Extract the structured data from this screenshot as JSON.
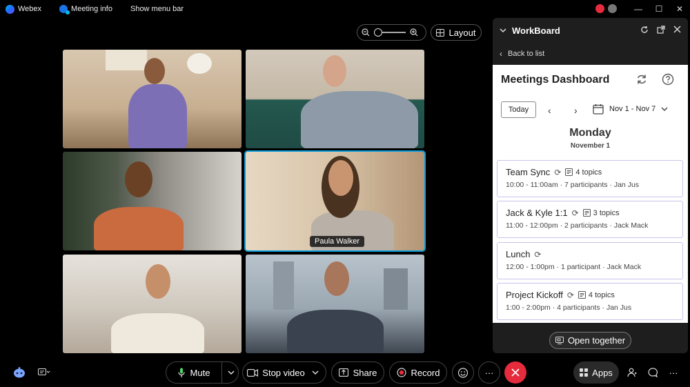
{
  "titlebar": {
    "app_name": "Webex",
    "meeting_info": "Meeting info",
    "show_menu_bar": "Show menu bar"
  },
  "view_controls": {
    "layout_label": "Layout"
  },
  "participants": [
    {
      "tile": 1
    },
    {
      "tile": 2
    },
    {
      "tile": 3
    },
    {
      "tile": 4,
      "name": "Paula Walker",
      "active_speaker": true
    },
    {
      "tile": 5
    },
    {
      "tile": 6
    }
  ],
  "workboard": {
    "title": "WorkBoard",
    "back_label": "Back to list",
    "dashboard_title": "Meetings Dashboard",
    "today_label": "Today",
    "date_range": "Nov 1 - Nov 7",
    "day_name": "Monday",
    "day_date": "November 1",
    "meetings": [
      {
        "title": "Team Sync",
        "recurring": true,
        "topics": "4 topics",
        "time": "10:00 - 11:00am",
        "participants": "7 participants",
        "owner": "Jan Jus"
      },
      {
        "title": "Jack & Kyle 1:1",
        "recurring": true,
        "topics": "3 topics",
        "time": "11:00 - 12:00pm",
        "participants": "2 participants",
        "owner": "Jack Mack"
      },
      {
        "title": "Lunch",
        "recurring": true,
        "topics": "",
        "time": "12:00 - 1:00pm",
        "participants": "1 participant",
        "owner": "Jack Mack"
      },
      {
        "title": "Project Kickoff",
        "recurring": true,
        "topics": "4 topics",
        "time": "1:00 - 2:00pm",
        "participants": "4 participants",
        "owner": "Jan Jus"
      }
    ],
    "open_together_label": "Open together"
  },
  "controls": {
    "mute_label": "Mute",
    "stop_video_label": "Stop video",
    "share_label": "Share",
    "record_label": "Record",
    "apps_label": "Apps",
    "leave_color": "#e52b3c",
    "accent_color": "#0a9cd8"
  }
}
